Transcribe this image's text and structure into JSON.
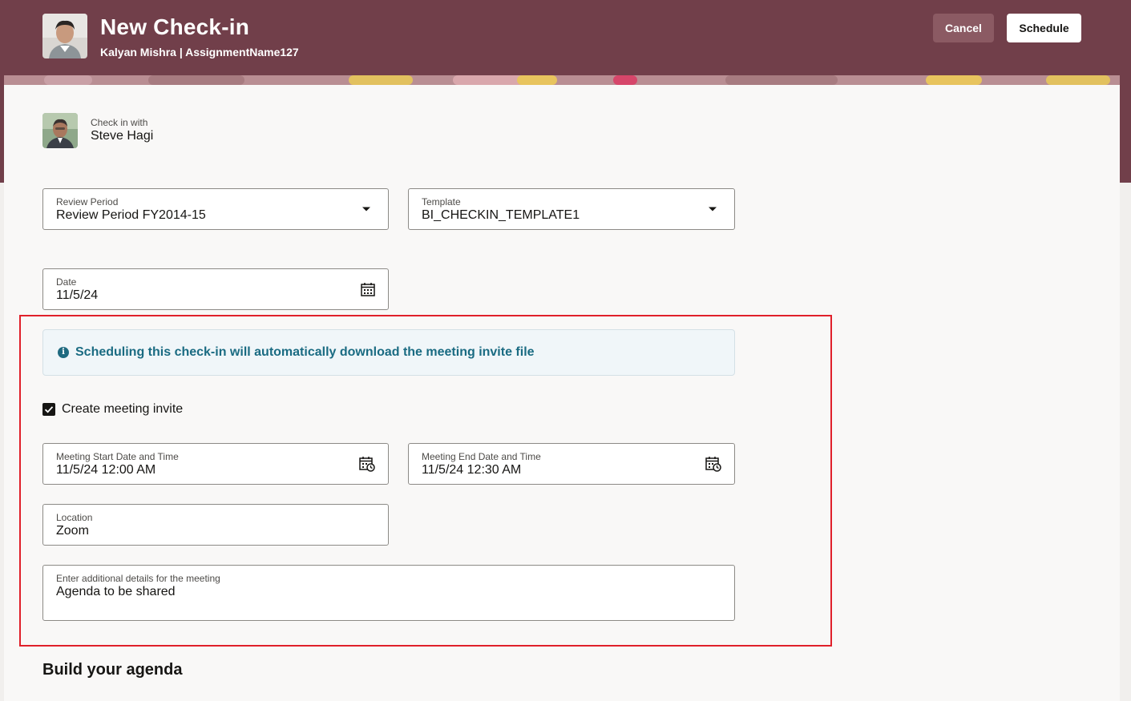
{
  "header": {
    "title": "New Check-in",
    "subtitle": "Kalyan Mishra | AssignmentName127",
    "cancel_label": "Cancel",
    "schedule_label": "Schedule",
    "brand_color": "#713f4a"
  },
  "checkin": {
    "label": "Check in with",
    "name": "Steve Hagi"
  },
  "form": {
    "review_period": {
      "label": "Review Period",
      "value": "Review Period FY2014-15"
    },
    "template": {
      "label": "Template",
      "value": "BI_CHECKIN_TEMPLATE1"
    },
    "date": {
      "label": "Date",
      "value": "11/5/24"
    }
  },
  "meeting": {
    "info_message": "Scheduling this check-in will automatically download the meeting invite file",
    "create_invite_label": "Create meeting invite",
    "create_invite_checked": true,
    "start": {
      "label": "Meeting Start Date and Time",
      "value": "11/5/24 12:00 AM"
    },
    "end": {
      "label": "Meeting End Date and Time",
      "value": "11/5/24 12:30 AM"
    },
    "location": {
      "label": "Location",
      "value": "Zoom"
    },
    "details": {
      "label": "Enter additional details for the meeting",
      "value": "Agenda to be shared"
    },
    "highlight_color": "#e0202a"
  },
  "agenda": {
    "title": "Build your agenda"
  },
  "icons": {
    "dropdown": "chevron-down-icon",
    "date": "calendar-icon",
    "datetime": "calendar-clock-icon",
    "info": "info-icon",
    "check": "checkmark-icon"
  }
}
